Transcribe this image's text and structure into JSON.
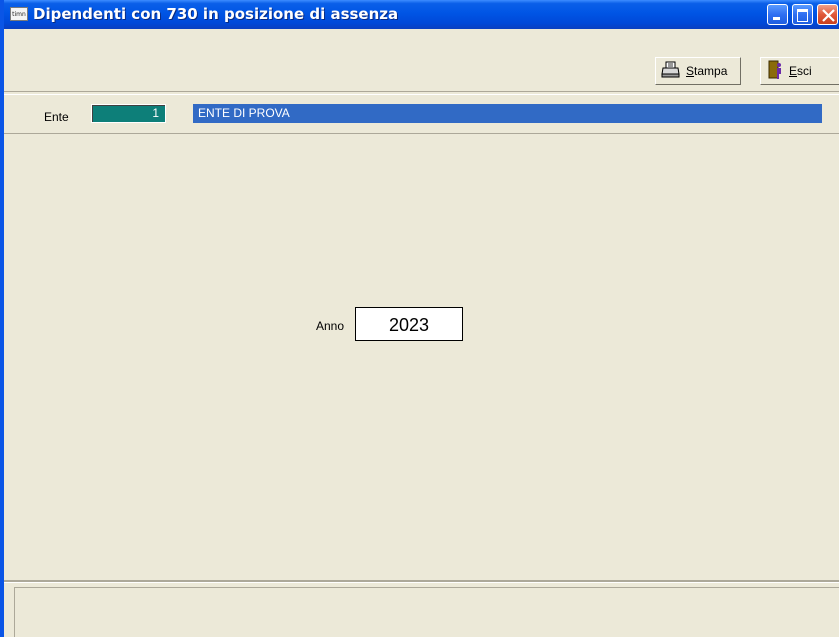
{
  "window": {
    "title": "Dipendenti con 730 in posizione di assenza",
    "app_icon_text": "timn"
  },
  "toolbar": {
    "stampa_label": "Stampa",
    "esci_label": "Esci"
  },
  "ente": {
    "label": "Ente",
    "code": "1",
    "name": "ENTE DI PROVA"
  },
  "form": {
    "anno_label": "Anno",
    "anno_value": "2023"
  },
  "colors": {
    "titlebar": "#0055e5",
    "ente_code_bg": "#0d7f79",
    "ente_name_bg": "#316ac5",
    "window_bg": "#ece9d8"
  }
}
